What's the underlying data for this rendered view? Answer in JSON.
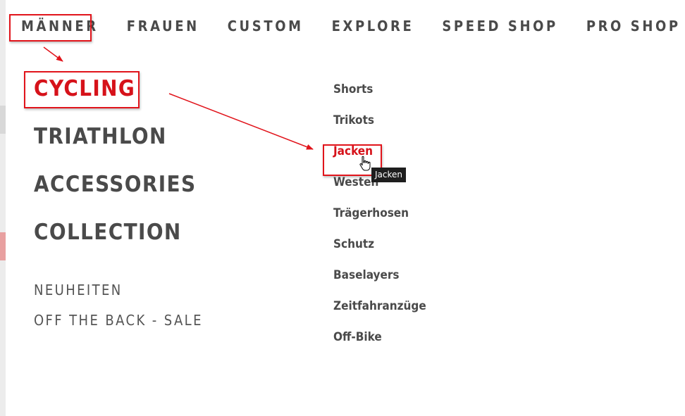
{
  "nav": {
    "items": [
      "Männer",
      "Frauen",
      "Custom",
      "Explore",
      "Speed Shop",
      "Pro Shop"
    ]
  },
  "categories": {
    "main": [
      "Cycling",
      "Triathlon",
      "Accessories",
      "Collection"
    ],
    "secondary": [
      "Neuheiten",
      "Off the Back - Sale"
    ]
  },
  "subcategories": [
    "Shorts",
    "Trikots",
    "Jacken",
    "Westen",
    "Trägerhosen",
    "Schutz",
    "Baselayers",
    "Zeitfahranzüge",
    "Off-Bike"
  ],
  "tooltip": {
    "text": "Jacken"
  },
  "colors": {
    "accent": "#d6121a",
    "text": "#4a4a4a",
    "highlight": "#e1141b"
  }
}
